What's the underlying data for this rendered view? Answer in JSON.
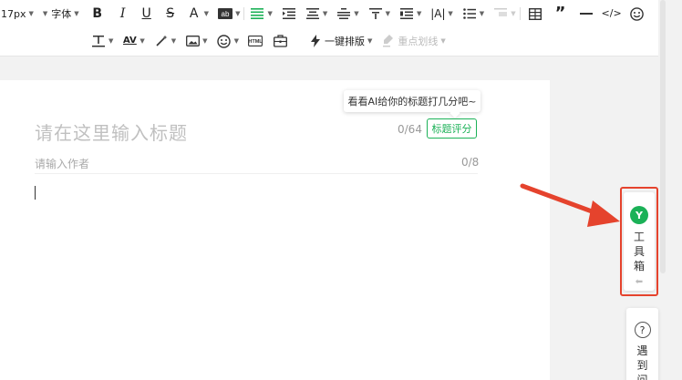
{
  "toolbar": {
    "font_size": "17px",
    "font_family": "字体",
    "one_click_layout": "一键排版",
    "highlight_line": "重点划线"
  },
  "editor": {
    "title_placeholder": "请在这里输入标题",
    "title_count": "0/64",
    "title_score_button": "标题评分",
    "title_tip": "看看AI给你的标题打几分吧~",
    "author_placeholder": "请输入作者",
    "author_count": "0/8"
  },
  "toolbox": {
    "label": "工具箱",
    "logo_letter": "Y"
  },
  "help": {
    "label": "遇到问"
  },
  "colors": {
    "accent_green": "#1bb157",
    "highlight_red": "#e5432d"
  }
}
